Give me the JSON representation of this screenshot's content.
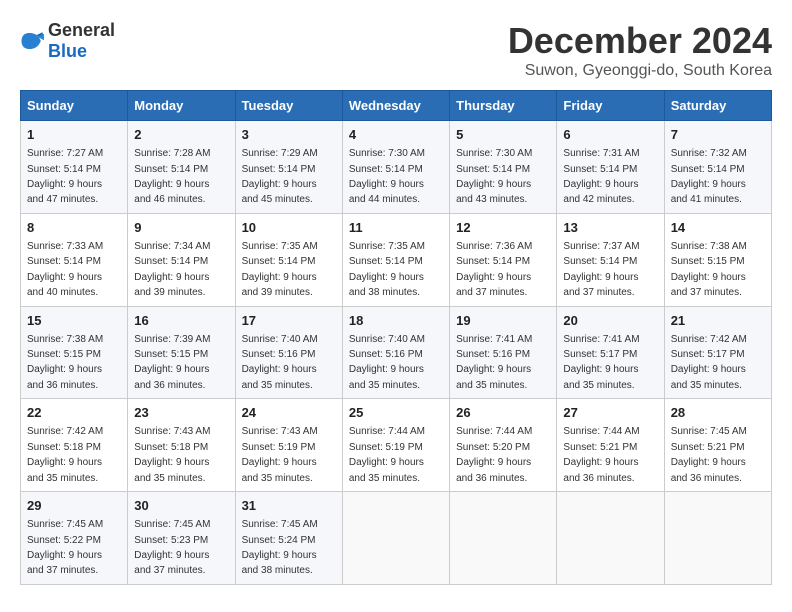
{
  "logo": {
    "general": "General",
    "blue": "Blue"
  },
  "title": "December 2024",
  "subtitle": "Suwon, Gyeonggi-do, South Korea",
  "headers": [
    "Sunday",
    "Monday",
    "Tuesday",
    "Wednesday",
    "Thursday",
    "Friday",
    "Saturday"
  ],
  "rows": [
    [
      {
        "day": "1",
        "sunrise": "Sunrise: 7:27 AM",
        "sunset": "Sunset: 5:14 PM",
        "daylight": "Daylight: 9 hours and 47 minutes."
      },
      {
        "day": "2",
        "sunrise": "Sunrise: 7:28 AM",
        "sunset": "Sunset: 5:14 PM",
        "daylight": "Daylight: 9 hours and 46 minutes."
      },
      {
        "day": "3",
        "sunrise": "Sunrise: 7:29 AM",
        "sunset": "Sunset: 5:14 PM",
        "daylight": "Daylight: 9 hours and 45 minutes."
      },
      {
        "day": "4",
        "sunrise": "Sunrise: 7:30 AM",
        "sunset": "Sunset: 5:14 PM",
        "daylight": "Daylight: 9 hours and 44 minutes."
      },
      {
        "day": "5",
        "sunrise": "Sunrise: 7:30 AM",
        "sunset": "Sunset: 5:14 PM",
        "daylight": "Daylight: 9 hours and 43 minutes."
      },
      {
        "day": "6",
        "sunrise": "Sunrise: 7:31 AM",
        "sunset": "Sunset: 5:14 PM",
        "daylight": "Daylight: 9 hours and 42 minutes."
      },
      {
        "day": "7",
        "sunrise": "Sunrise: 7:32 AM",
        "sunset": "Sunset: 5:14 PM",
        "daylight": "Daylight: 9 hours and 41 minutes."
      }
    ],
    [
      {
        "day": "8",
        "sunrise": "Sunrise: 7:33 AM",
        "sunset": "Sunset: 5:14 PM",
        "daylight": "Daylight: 9 hours and 40 minutes."
      },
      {
        "day": "9",
        "sunrise": "Sunrise: 7:34 AM",
        "sunset": "Sunset: 5:14 PM",
        "daylight": "Daylight: 9 hours and 39 minutes."
      },
      {
        "day": "10",
        "sunrise": "Sunrise: 7:35 AM",
        "sunset": "Sunset: 5:14 PM",
        "daylight": "Daylight: 9 hours and 39 minutes."
      },
      {
        "day": "11",
        "sunrise": "Sunrise: 7:35 AM",
        "sunset": "Sunset: 5:14 PM",
        "daylight": "Daylight: 9 hours and 38 minutes."
      },
      {
        "day": "12",
        "sunrise": "Sunrise: 7:36 AM",
        "sunset": "Sunset: 5:14 PM",
        "daylight": "Daylight: 9 hours and 37 minutes."
      },
      {
        "day": "13",
        "sunrise": "Sunrise: 7:37 AM",
        "sunset": "Sunset: 5:14 PM",
        "daylight": "Daylight: 9 hours and 37 minutes."
      },
      {
        "day": "14",
        "sunrise": "Sunrise: 7:38 AM",
        "sunset": "Sunset: 5:15 PM",
        "daylight": "Daylight: 9 hours and 37 minutes."
      }
    ],
    [
      {
        "day": "15",
        "sunrise": "Sunrise: 7:38 AM",
        "sunset": "Sunset: 5:15 PM",
        "daylight": "Daylight: 9 hours and 36 minutes."
      },
      {
        "day": "16",
        "sunrise": "Sunrise: 7:39 AM",
        "sunset": "Sunset: 5:15 PM",
        "daylight": "Daylight: 9 hours and 36 minutes."
      },
      {
        "day": "17",
        "sunrise": "Sunrise: 7:40 AM",
        "sunset": "Sunset: 5:16 PM",
        "daylight": "Daylight: 9 hours and 35 minutes."
      },
      {
        "day": "18",
        "sunrise": "Sunrise: 7:40 AM",
        "sunset": "Sunset: 5:16 PM",
        "daylight": "Daylight: 9 hours and 35 minutes."
      },
      {
        "day": "19",
        "sunrise": "Sunrise: 7:41 AM",
        "sunset": "Sunset: 5:16 PM",
        "daylight": "Daylight: 9 hours and 35 minutes."
      },
      {
        "day": "20",
        "sunrise": "Sunrise: 7:41 AM",
        "sunset": "Sunset: 5:17 PM",
        "daylight": "Daylight: 9 hours and 35 minutes."
      },
      {
        "day": "21",
        "sunrise": "Sunrise: 7:42 AM",
        "sunset": "Sunset: 5:17 PM",
        "daylight": "Daylight: 9 hours and 35 minutes."
      }
    ],
    [
      {
        "day": "22",
        "sunrise": "Sunrise: 7:42 AM",
        "sunset": "Sunset: 5:18 PM",
        "daylight": "Daylight: 9 hours and 35 minutes."
      },
      {
        "day": "23",
        "sunrise": "Sunrise: 7:43 AM",
        "sunset": "Sunset: 5:18 PM",
        "daylight": "Daylight: 9 hours and 35 minutes."
      },
      {
        "day": "24",
        "sunrise": "Sunrise: 7:43 AM",
        "sunset": "Sunset: 5:19 PM",
        "daylight": "Daylight: 9 hours and 35 minutes."
      },
      {
        "day": "25",
        "sunrise": "Sunrise: 7:44 AM",
        "sunset": "Sunset: 5:19 PM",
        "daylight": "Daylight: 9 hours and 35 minutes."
      },
      {
        "day": "26",
        "sunrise": "Sunrise: 7:44 AM",
        "sunset": "Sunset: 5:20 PM",
        "daylight": "Daylight: 9 hours and 36 minutes."
      },
      {
        "day": "27",
        "sunrise": "Sunrise: 7:44 AM",
        "sunset": "Sunset: 5:21 PM",
        "daylight": "Daylight: 9 hours and 36 minutes."
      },
      {
        "day": "28",
        "sunrise": "Sunrise: 7:45 AM",
        "sunset": "Sunset: 5:21 PM",
        "daylight": "Daylight: 9 hours and 36 minutes."
      }
    ],
    [
      {
        "day": "29",
        "sunrise": "Sunrise: 7:45 AM",
        "sunset": "Sunset: 5:22 PM",
        "daylight": "Daylight: 9 hours and 37 minutes."
      },
      {
        "day": "30",
        "sunrise": "Sunrise: 7:45 AM",
        "sunset": "Sunset: 5:23 PM",
        "daylight": "Daylight: 9 hours and 37 minutes."
      },
      {
        "day": "31",
        "sunrise": "Sunrise: 7:45 AM",
        "sunset": "Sunset: 5:24 PM",
        "daylight": "Daylight: 9 hours and 38 minutes."
      },
      null,
      null,
      null,
      null
    ]
  ]
}
